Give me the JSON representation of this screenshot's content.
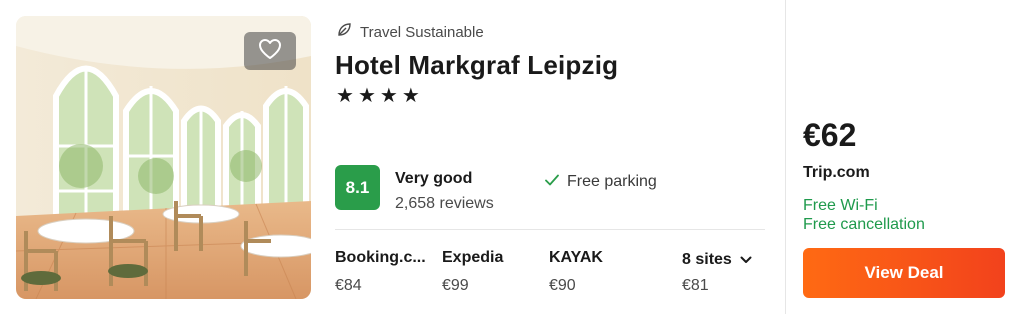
{
  "hotel": {
    "sustainability_label": "Travel Sustainable",
    "name": "Hotel Markgraf Leipzig",
    "stars": [
      "★",
      "★",
      "★",
      "★"
    ],
    "rating_score": "8.1",
    "rating_label": "Very good",
    "reviews": "2,658 reviews",
    "amenity": "Free parking"
  },
  "sites": [
    {
      "name": "Booking.c...",
      "price": "€84"
    },
    {
      "name": "Expedia",
      "price": "€99"
    },
    {
      "name": "KAYAK",
      "price": "€90"
    }
  ],
  "more_sites": {
    "label": "8 sites",
    "price": "€81"
  },
  "deal": {
    "price": "€62",
    "site": "Trip.com",
    "perks": [
      "Free Wi-Fi",
      "Free cancellation"
    ],
    "button_label": "View Deal"
  },
  "icons": {
    "favorite": "heart-outline-icon",
    "sustainable": "leaf-icon",
    "amenity": "check-icon",
    "expand": "chevron-down-icon"
  },
  "colors": {
    "rating_badge": "#2a9d4a",
    "perk_text": "#1f9a4c",
    "button_start": "#ff6a13",
    "button_end": "#f2421c"
  }
}
